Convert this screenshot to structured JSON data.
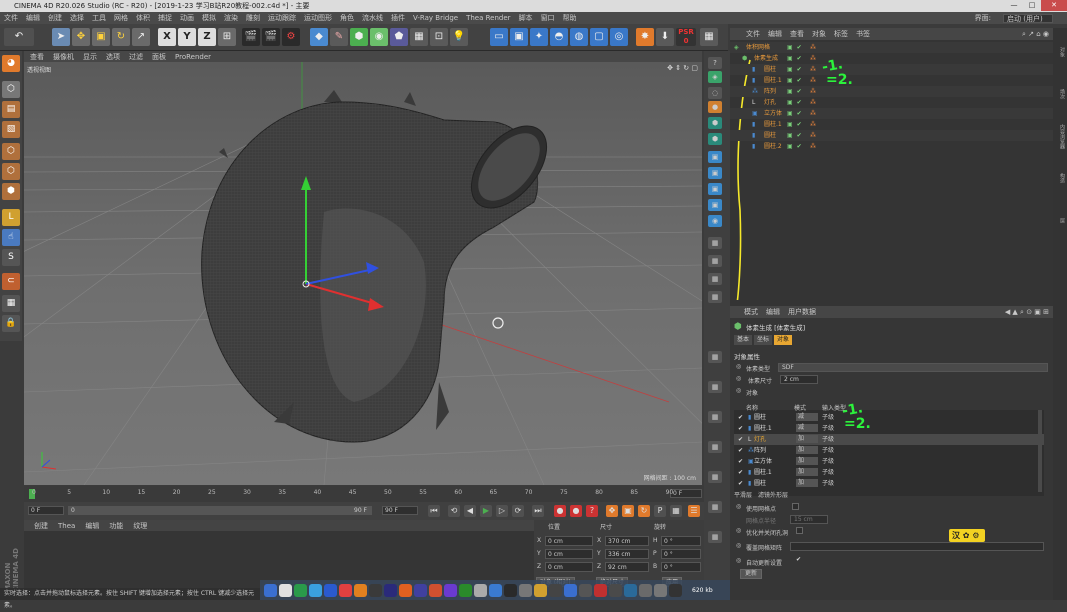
{
  "window": {
    "title": "CINEMA 4D R20.026 Studio (RC - R20) - [2019-1-23 学习B站R20教程-002.c4d *] - 主要"
  },
  "menubar": {
    "items": [
      "文件",
      "编辑",
      "创建",
      "选择",
      "工具",
      "网格",
      "体积",
      "捕捉",
      "动画",
      "模拟",
      "渲染",
      "雕刻",
      "运动跟踪",
      "运动图形",
      "角色",
      "流水线",
      "插件",
      "V-Ray Bridge",
      "Thea Render",
      "脚本",
      "窗口",
      "帮助"
    ],
    "layout_label": "界面:",
    "layout_value": "启动 (用户)"
  },
  "viewport": {
    "menu": [
      "查看",
      "摄像机",
      "显示",
      "选项",
      "过滤",
      "面板",
      "ProRender"
    ],
    "label": "透视视图",
    "grid_info": "网格间距 : 100 cm"
  },
  "timeline": {
    "ticks": [
      "0",
      "5",
      "10",
      "15",
      "20",
      "25",
      "30",
      "35",
      "40",
      "45",
      "50",
      "55",
      "60",
      "65",
      "70",
      "75",
      "80",
      "85",
      "90"
    ],
    "current": "0 F",
    "start_field": "0 F",
    "range_start": "0",
    "range_end": "90 F",
    "end_field": "90 F"
  },
  "material_manager": {
    "menu": [
      "创建",
      "Thea",
      "编辑",
      "功能",
      "纹理"
    ]
  },
  "coordinates": {
    "headers": [
      "位置",
      "尺寸",
      "旋转"
    ],
    "rows": [
      {
        "axis": "X",
        "pos": "0 cm",
        "size_axis": "X",
        "size": "370 cm",
        "rot_axis": "H",
        "rot": "0 °"
      },
      {
        "axis": "Y",
        "pos": "0 cm",
        "size_axis": "Y",
        "size": "336 cm",
        "rot_axis": "P",
        "rot": "0 °"
      },
      {
        "axis": "Z",
        "pos": "0 cm",
        "size_axis": "Z",
        "size": "92 cm",
        "rot_axis": "B",
        "rot": "0 °"
      }
    ],
    "mode": "对象 (相对)",
    "size_mode": "绝对尺寸",
    "apply": "应用"
  },
  "object_manager": {
    "menu": [
      "文件",
      "编辑",
      "查看",
      "对象",
      "标签",
      "书签"
    ],
    "rows": [
      {
        "name": "体积网格"
      },
      {
        "name": "体素生成"
      },
      {
        "name": "圆柱"
      },
      {
        "name": "圆柱.1"
      },
      {
        "name": "阵列"
      },
      {
        "name": "灯孔"
      },
      {
        "name": "立方体"
      },
      {
        "name": "圆柱.1"
      },
      {
        "name": "圆柱"
      },
      {
        "name": "圆柱.2"
      }
    ]
  },
  "attributes": {
    "menu": [
      "模式",
      "编辑",
      "用户数据"
    ],
    "title": "体素生成 [体素生成]",
    "tabs": [
      "基本",
      "坐标",
      "对象"
    ],
    "active_tab": "对象",
    "section": "对象属性",
    "voxel_type_label": "体素类型",
    "voxel_type": "SDF",
    "voxel_size_label": "体素尺寸",
    "voxel_size": "2 cm",
    "objects_label": "对象",
    "table_headers": [
      "名称",
      "模式",
      "输入类型"
    ],
    "table_rows": [
      {
        "name": "圆柱",
        "mode": "减",
        "type": "子级"
      },
      {
        "name": "圆柱.1",
        "mode": "减",
        "type": "子级"
      },
      {
        "name": "灯孔",
        "mode": "加",
        "type": "子级"
      },
      {
        "name": "阵列",
        "mode": "加",
        "type": "子级"
      },
      {
        "name": "立方体",
        "mode": "加",
        "type": "子级"
      },
      {
        "name": "圆柱.1",
        "mode": "加",
        "type": "子级"
      },
      {
        "name": "圆柱",
        "mode": "加",
        "type": "子级"
      }
    ],
    "bottom_tabs": [
      "平滑层",
      "滤镜外形层"
    ],
    "use_grid_points": "使用网格点",
    "grid_radius_label": "网格点半径",
    "grid_radius": "15 cm",
    "optimize": "优化并关闭孔洞",
    "override_label": "覆盖网格矩阵",
    "auto_update": "自动更新设置",
    "update_btn": "更新"
  },
  "right_strip": [
    "对象",
    "场次",
    "内容浏览器",
    "构造",
    "层"
  ],
  "status": {
    "text": "实时选择：点击并拖动鼠标选择元素。按住 SHIFT 键增加选择元素；按住 CTRL 键减少选择元素。"
  },
  "taskbar": {
    "size_text": "620 kb"
  },
  "ime": {
    "label": "汉"
  },
  "annotations": {
    "a1": "-1.",
    "a2": "=2.",
    "b1": "-1.",
    "b2": "=2."
  }
}
